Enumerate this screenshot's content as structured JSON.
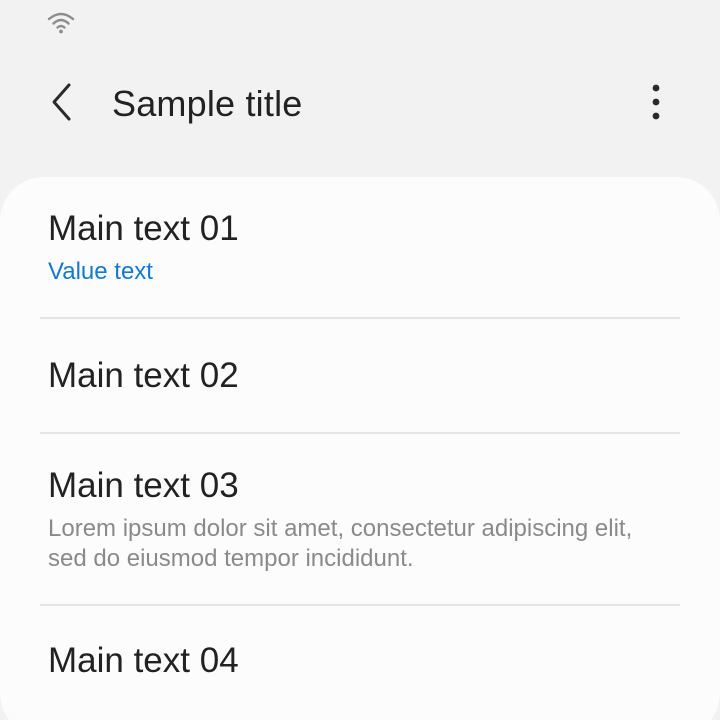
{
  "status_bar": {
    "wifi_icon": "wifi-icon"
  },
  "app_bar": {
    "back_icon": "chevron-left-icon",
    "title": "Sample title",
    "more_icon": "more-vertical-icon"
  },
  "list": {
    "items": [
      {
        "main": "Main text 01",
        "value": "Value text"
      },
      {
        "main": "Main text 02"
      },
      {
        "main": "Main text 03",
        "secondary": "Lorem ipsum dolor sit amet, consectetur adipiscing elit, sed do eiusmod tempor incididunt."
      },
      {
        "main": "Main text 04"
      }
    ]
  },
  "colors": {
    "background": "#f2f2f2",
    "card": "#fcfcfc",
    "accent": "#1378d2",
    "primary_text": "#222222",
    "secondary_text": "#8a8a8a",
    "divider": "#e5e5e5"
  }
}
